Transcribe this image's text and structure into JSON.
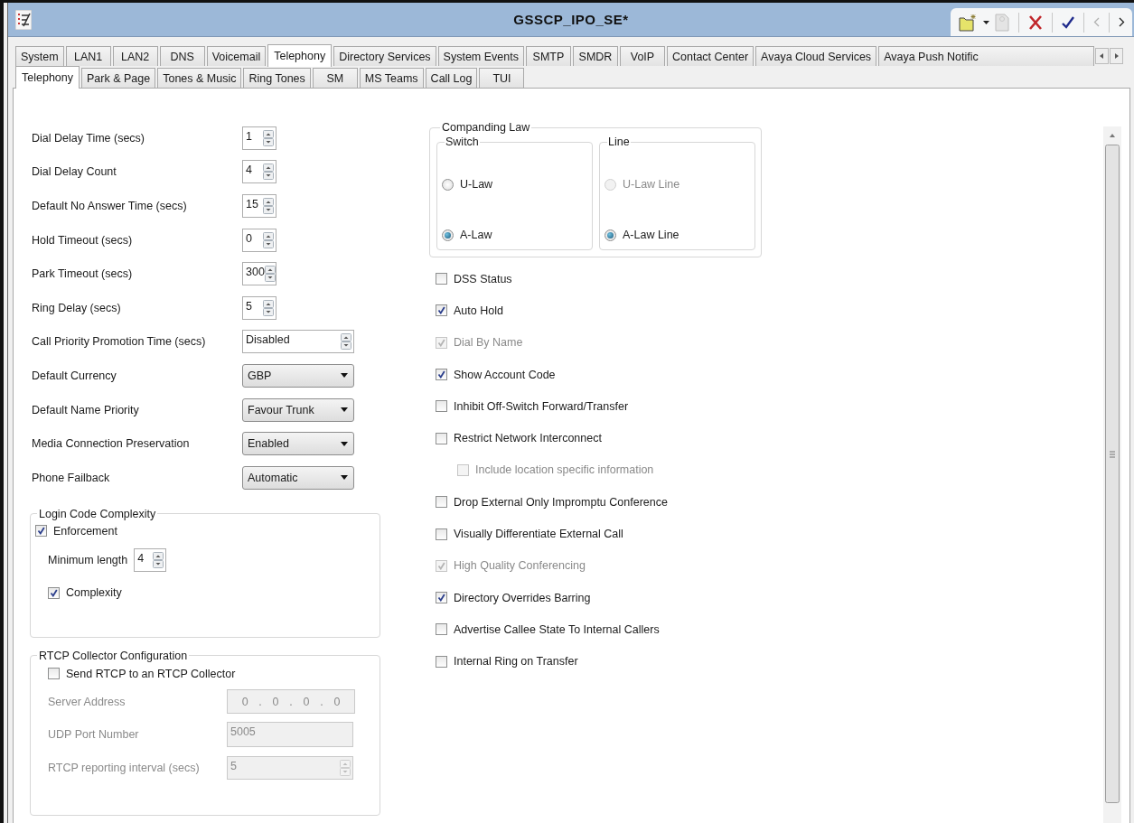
{
  "window": {
    "title": "GSSCP_IPO_SE*"
  },
  "toolbar": [
    {
      "kind": "new",
      "disabled": false
    },
    {
      "kind": "dropdown",
      "disabled": false
    },
    {
      "kind": "save",
      "disabled": true
    },
    {
      "kind": "cancel",
      "disabled": false
    },
    {
      "kind": "ok",
      "disabled": false
    },
    {
      "kind": "prev",
      "disabled": true
    },
    {
      "kind": "next",
      "disabled": false
    }
  ],
  "tabs": [
    {
      "label": "System",
      "selected": false
    },
    {
      "label": "LAN1",
      "selected": false
    },
    {
      "label": "LAN2",
      "selected": false
    },
    {
      "label": "DNS",
      "selected": false
    },
    {
      "label": "Voicemail",
      "selected": false
    },
    {
      "label": "Telephony",
      "selected": true
    },
    {
      "label": "Directory Services",
      "selected": false
    },
    {
      "label": "System Events",
      "selected": false
    },
    {
      "label": "SMTP",
      "selected": false
    },
    {
      "label": "SMDR",
      "selected": false
    },
    {
      "label": "VoIP",
      "selected": false
    },
    {
      "label": "Contact Center",
      "selected": false
    },
    {
      "label": "Avaya Cloud Services",
      "selected": false
    },
    {
      "label": "Avaya Push Notific",
      "selected": false
    }
  ],
  "subtabs": [
    {
      "label": "Telephony",
      "selected": true
    },
    {
      "label": "Park & Page",
      "selected": false
    },
    {
      "label": "Tones & Music",
      "selected": false
    },
    {
      "label": "Ring Tones",
      "selected": false
    },
    {
      "label": "SM",
      "selected": false
    },
    {
      "label": "MS Teams",
      "selected": false
    },
    {
      "label": "Call Log",
      "selected": false
    },
    {
      "label": "TUI",
      "selected": false
    }
  ],
  "fields": [
    {
      "kind": "spin",
      "label": "Dial Delay Time (secs)",
      "value": "1"
    },
    {
      "kind": "spin",
      "label": "Dial Delay Count",
      "value": "4"
    },
    {
      "kind": "spin",
      "label": "Default No Answer Time (secs)",
      "value": "15"
    },
    {
      "kind": "spin",
      "label": "Hold Timeout (secs)",
      "value": "0"
    },
    {
      "kind": "spin",
      "label": "Park Timeout (secs)",
      "value": "300"
    },
    {
      "kind": "spin",
      "label": "Ring Delay (secs)",
      "value": "5"
    },
    {
      "kind": "wide",
      "label": "Call Priority Promotion Time (secs)",
      "value": "Disabled"
    },
    {
      "kind": "select",
      "label": "Default Currency",
      "value": "GBP"
    },
    {
      "kind": "select",
      "label": "Default Name Priority",
      "value": "Favour Trunk"
    },
    {
      "kind": "select",
      "label": "Media Connection Preservation",
      "value": "Enabled"
    },
    {
      "kind": "select",
      "label": "Phone Failback",
      "value": "Automatic"
    }
  ],
  "login_code_complexity": {
    "title": "Login Code Complexity",
    "enforcement": {
      "label": "Enforcement",
      "checked": true
    },
    "minimum_length": {
      "label": "Minimum length",
      "value": "4"
    },
    "complexity": {
      "label": "Complexity",
      "checked": true
    }
  },
  "rtcp_collector": {
    "title": "RTCP Collector Configuration",
    "send": {
      "label": "Send RTCP to an RTCP Collector",
      "checked": false
    },
    "server_address": {
      "label": "Server Address",
      "octets": [
        "0",
        "0",
        "0",
        "0"
      ],
      "separators": [
        ".",
        ".",
        "."
      ],
      "disabled": true
    },
    "udp_port": {
      "label": "UDP Port Number",
      "value": "5005",
      "disabled": true
    },
    "reporting_interval": {
      "label": "RTCP reporting interval (secs)",
      "value": "5",
      "disabled": true
    }
  },
  "companding_law": {
    "title": "Companding Law",
    "groups": [
      {
        "title": "Switch",
        "options": [
          {
            "label": "U-Law",
            "selected": false,
            "disabled": false
          },
          {
            "label": "A-Law",
            "selected": true,
            "disabled": false
          }
        ]
      },
      {
        "title": "Line",
        "options": [
          {
            "label": "U-Law Line",
            "selected": false,
            "disabled": true
          },
          {
            "label": "A-Law Line",
            "selected": true,
            "disabled": false
          }
        ]
      }
    ]
  },
  "options": [
    {
      "label": "DSS Status",
      "checked": false,
      "disabled": false
    },
    {
      "label": "Auto Hold",
      "checked": true,
      "disabled": false
    },
    {
      "label": "Dial By Name",
      "checked": true,
      "disabled": true
    },
    {
      "label": "Show Account Code",
      "checked": true,
      "disabled": false
    },
    {
      "label": "Inhibit Off-Switch Forward/Transfer",
      "checked": false,
      "disabled": false
    },
    {
      "label": "Restrict Network Interconnect",
      "checked": false,
      "disabled": false,
      "children": [
        {
          "label": "Include location specific information",
          "checked": false,
          "disabled": true
        }
      ]
    },
    {
      "label": "Drop External Only Impromptu Conference",
      "checked": false,
      "disabled": false
    },
    {
      "label": "Visually Differentiate External Call",
      "checked": false,
      "disabled": false
    },
    {
      "label": "High Quality Conferencing",
      "checked": true,
      "disabled": true
    },
    {
      "label": "Directory Overrides Barring",
      "checked": true,
      "disabled": false
    },
    {
      "label": "Advertise Callee State To Internal Callers",
      "checked": false,
      "disabled": false
    },
    {
      "label": "Internal Ring on Transfer",
      "checked": false,
      "disabled": false
    }
  ]
}
